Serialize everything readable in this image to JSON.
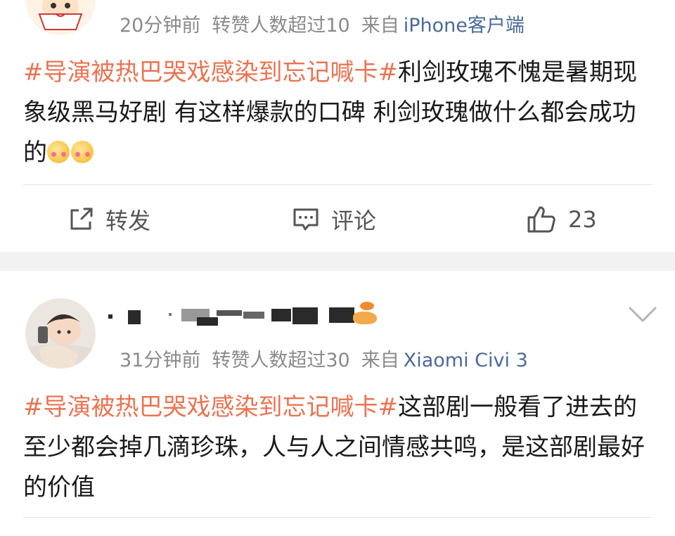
{
  "posts": [
    {
      "meta": {
        "time": "20分钟前",
        "reposts": "转赞人数超过10",
        "source_prefix": "来自",
        "source": "iPhone客户端"
      },
      "hashtag": "#导演被热巴哭戏感染到忘记喊卡#",
      "text": "利剑玫瑰不愧是暑期现象级黑马好剧 有这样爆款的口碑 利剑玫瑰做什么都会成功的",
      "emojis": [
        "blush-heart-emoji",
        "blush-heart-emoji"
      ],
      "actions": {
        "repost": "转发",
        "comment": "评论",
        "like_count": "23"
      }
    },
    {
      "meta": {
        "time": "31分钟前",
        "reposts": "转赞人数超过30",
        "source_prefix": "来自",
        "source": "Xiaomi Civi 3"
      },
      "hashtag": "#导演被热巴哭戏感染到忘记喊卡#",
      "text": "这部剧一般看了进去的至少都会掉几滴珍珠，人与人之间情感共鸣，是这部剧最好的价值"
    }
  ],
  "colors": {
    "hashtag": "#eb7350",
    "source_link": "#4a6a9a",
    "meta_text": "#8a8a8a",
    "separator": "#f2f2f2"
  },
  "icons": [
    "repost-icon",
    "comment-icon",
    "like-icon",
    "chevron-down-icon"
  ]
}
